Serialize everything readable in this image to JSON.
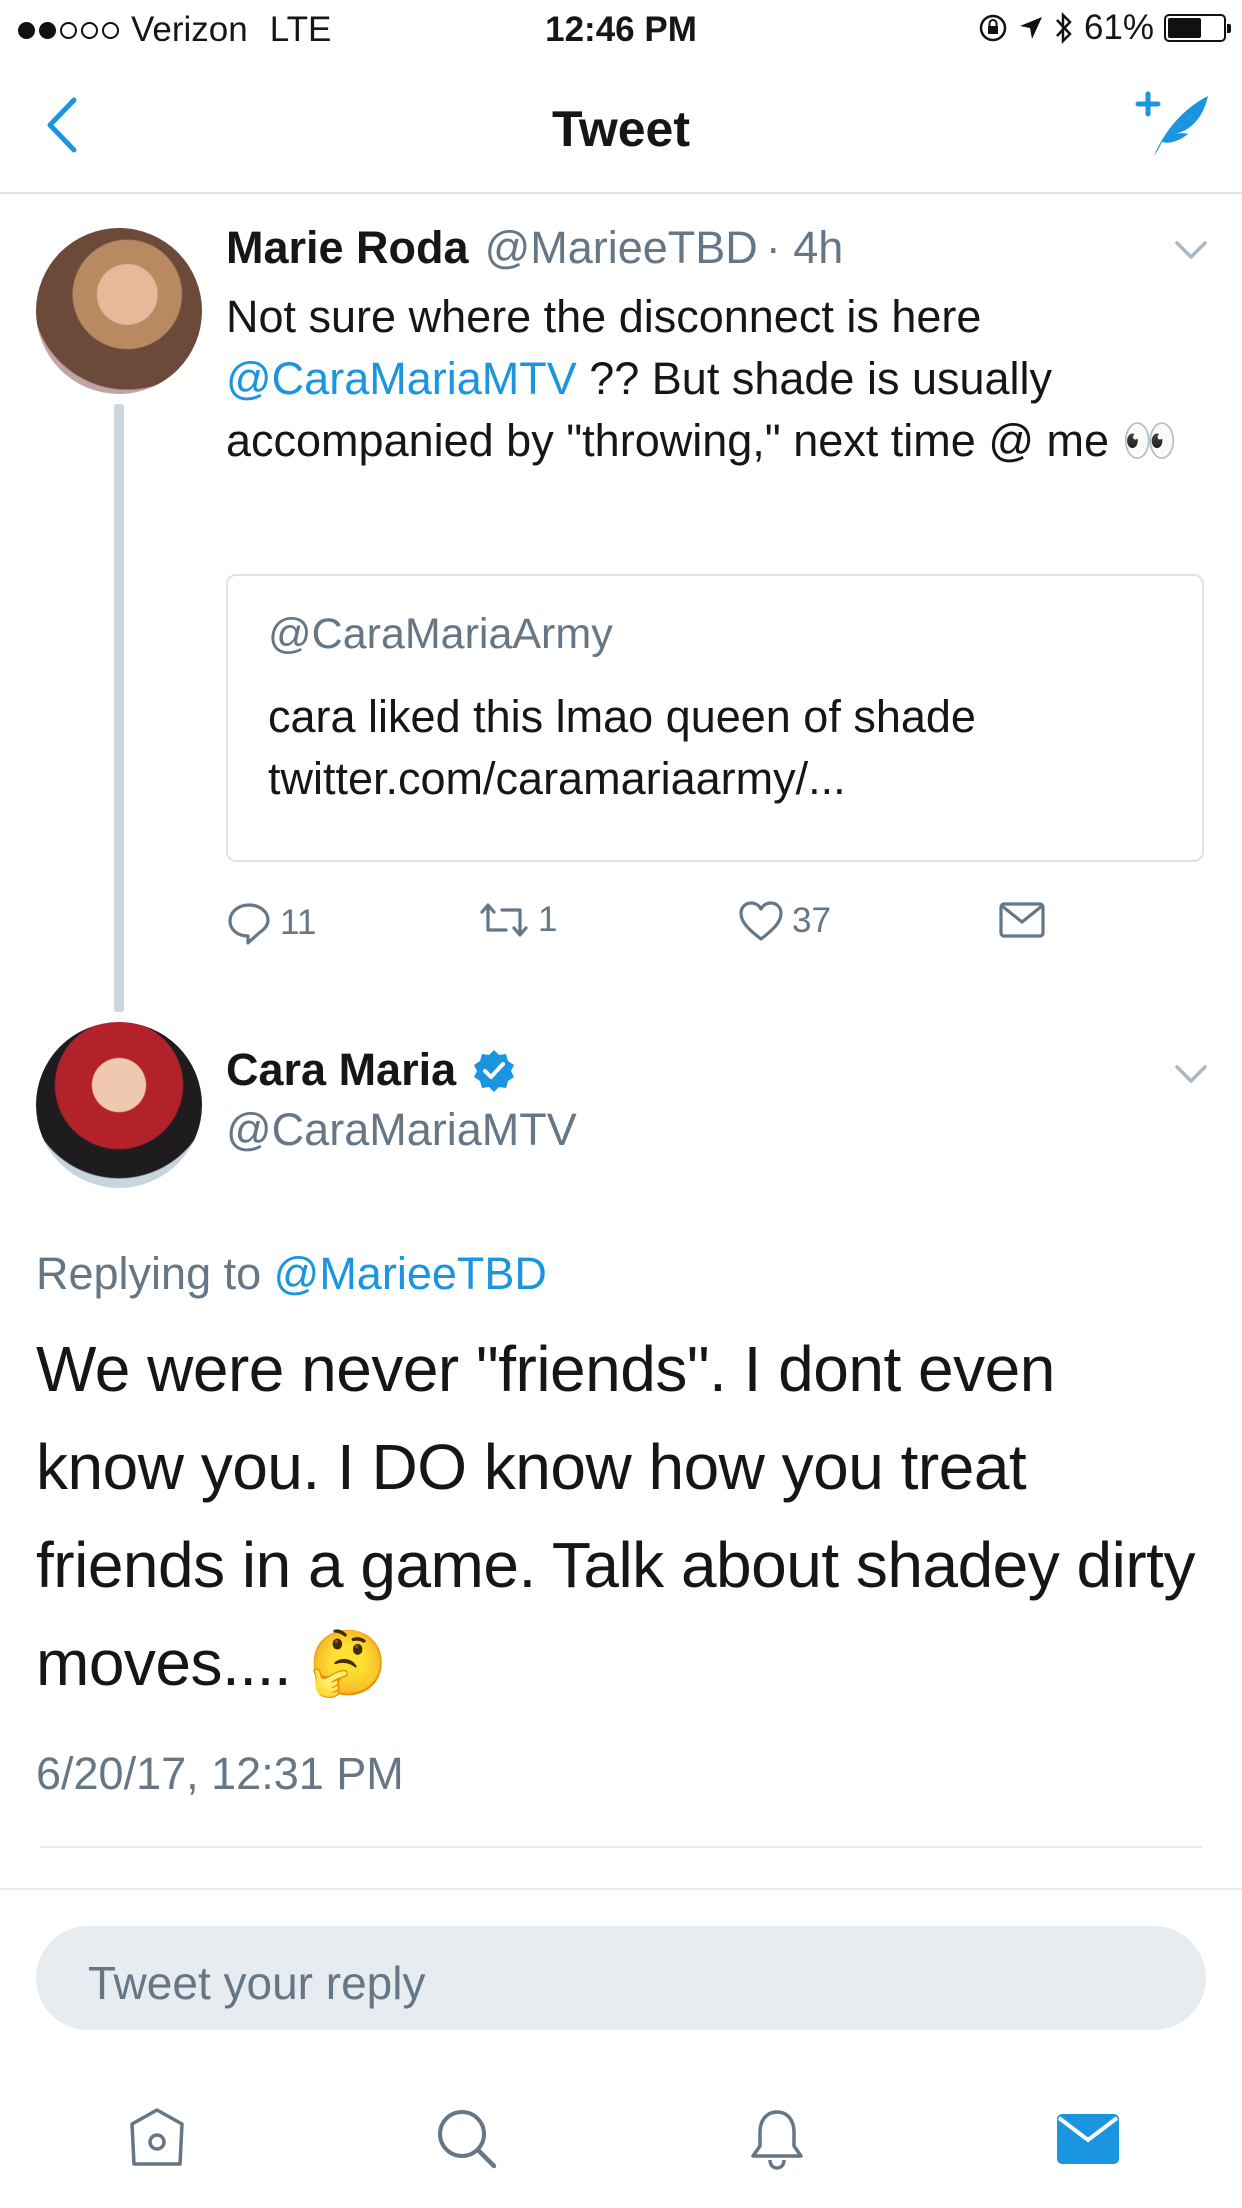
{
  "status_bar": {
    "carrier": "Verizon",
    "network": "LTE",
    "time": "12:46 PM",
    "battery": "61%",
    "battery_level": 0.61
  },
  "nav": {
    "title": "Tweet",
    "back_icon": "chevron-left-icon",
    "compose_icon": "compose-tweet-icon"
  },
  "tweet1": {
    "name": "Marie Roda",
    "handle": "@MarieeTBD",
    "time": "· 4h",
    "text_part1": "Not sure where the disconnect is here ",
    "mention": "@CaraMariaMTV",
    "text_part2": " ?? But shade is usually accompanied by \"throwing,\" next time @ me ",
    "emoji": "👀",
    "quote": {
      "handle": "@CaraMariaArmy",
      "text": "cara liked this lmao queen of shade twitter.com/caramariaarmy/..."
    },
    "replies": "11",
    "retweets": "1",
    "likes": "37"
  },
  "tweet2": {
    "name": "Cara Maria",
    "handle": "@CaraMariaMTV",
    "verified": true,
    "reply_label": "Replying to ",
    "reply_mention": "@MarieeTBD",
    "text": "We were never \"friends\". I dont even know you. I DO know how you treat friends in a game. Talk about shadey dirty moves.... ",
    "emoji": "🤔",
    "timestamp": "6/20/17, 12:31 PM"
  },
  "reply_input": {
    "placeholder": "Tweet your reply"
  },
  "tab_bar": {
    "items": [
      "home-icon",
      "search-icon",
      "notifications-icon",
      "messages-icon"
    ],
    "active": "messages-icon"
  },
  "colors": {
    "accent": "#1b95e0",
    "text": "#14171a",
    "secondary": "#657786",
    "border": "#e6ecf0"
  }
}
